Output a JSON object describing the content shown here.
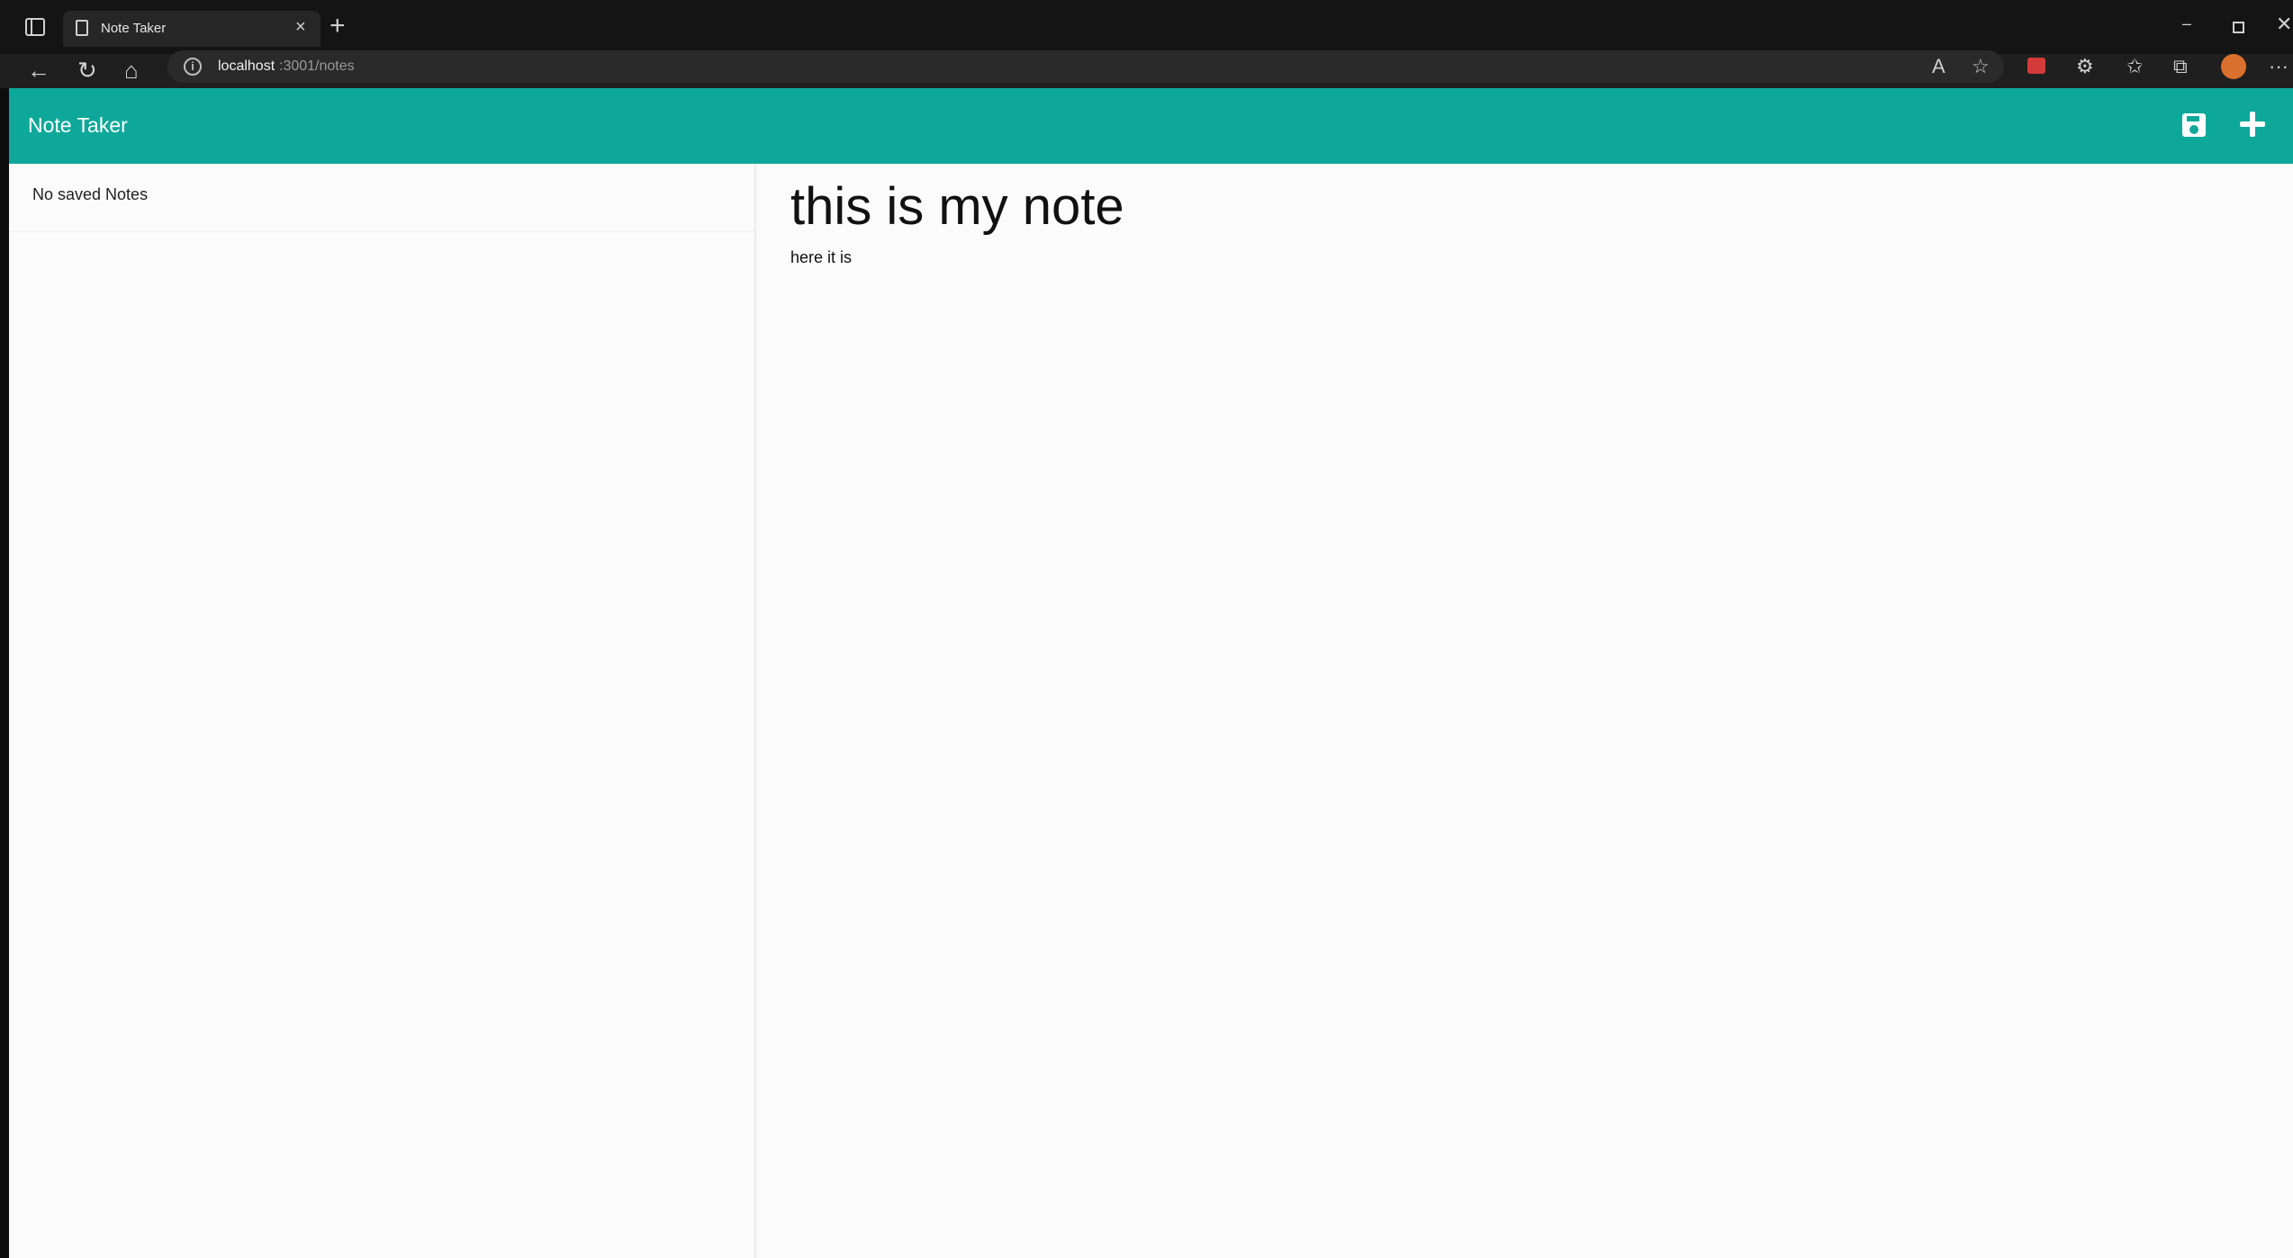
{
  "browser": {
    "tab_title": "Note Taker",
    "tab_close_glyph": "×",
    "new_tab_glyph": "+",
    "address_host": "localhost",
    "address_path": ":3001/notes",
    "window_min_glyph": "–",
    "window_close_glyph": "✕",
    "back_glyph": "←",
    "refresh_glyph": "↻",
    "home_glyph": "⌂",
    "info_glyph": "i",
    "read_aloud_glyph": "A",
    "favorite_glyph": "☆",
    "extensions_glyph": "⚙",
    "favorites_glyph": "✩",
    "collections_glyph": "⧉",
    "more_glyph": "···"
  },
  "app": {
    "brand": "Note Taker",
    "list": {
      "empty_message": "No saved Notes"
    },
    "editor": {
      "title_value": "this is my note",
      "body_value": "here it is"
    }
  },
  "colors": {
    "navbar": "#0ea89a"
  },
  "icons": [
    "save-icon",
    "add-icon"
  ]
}
